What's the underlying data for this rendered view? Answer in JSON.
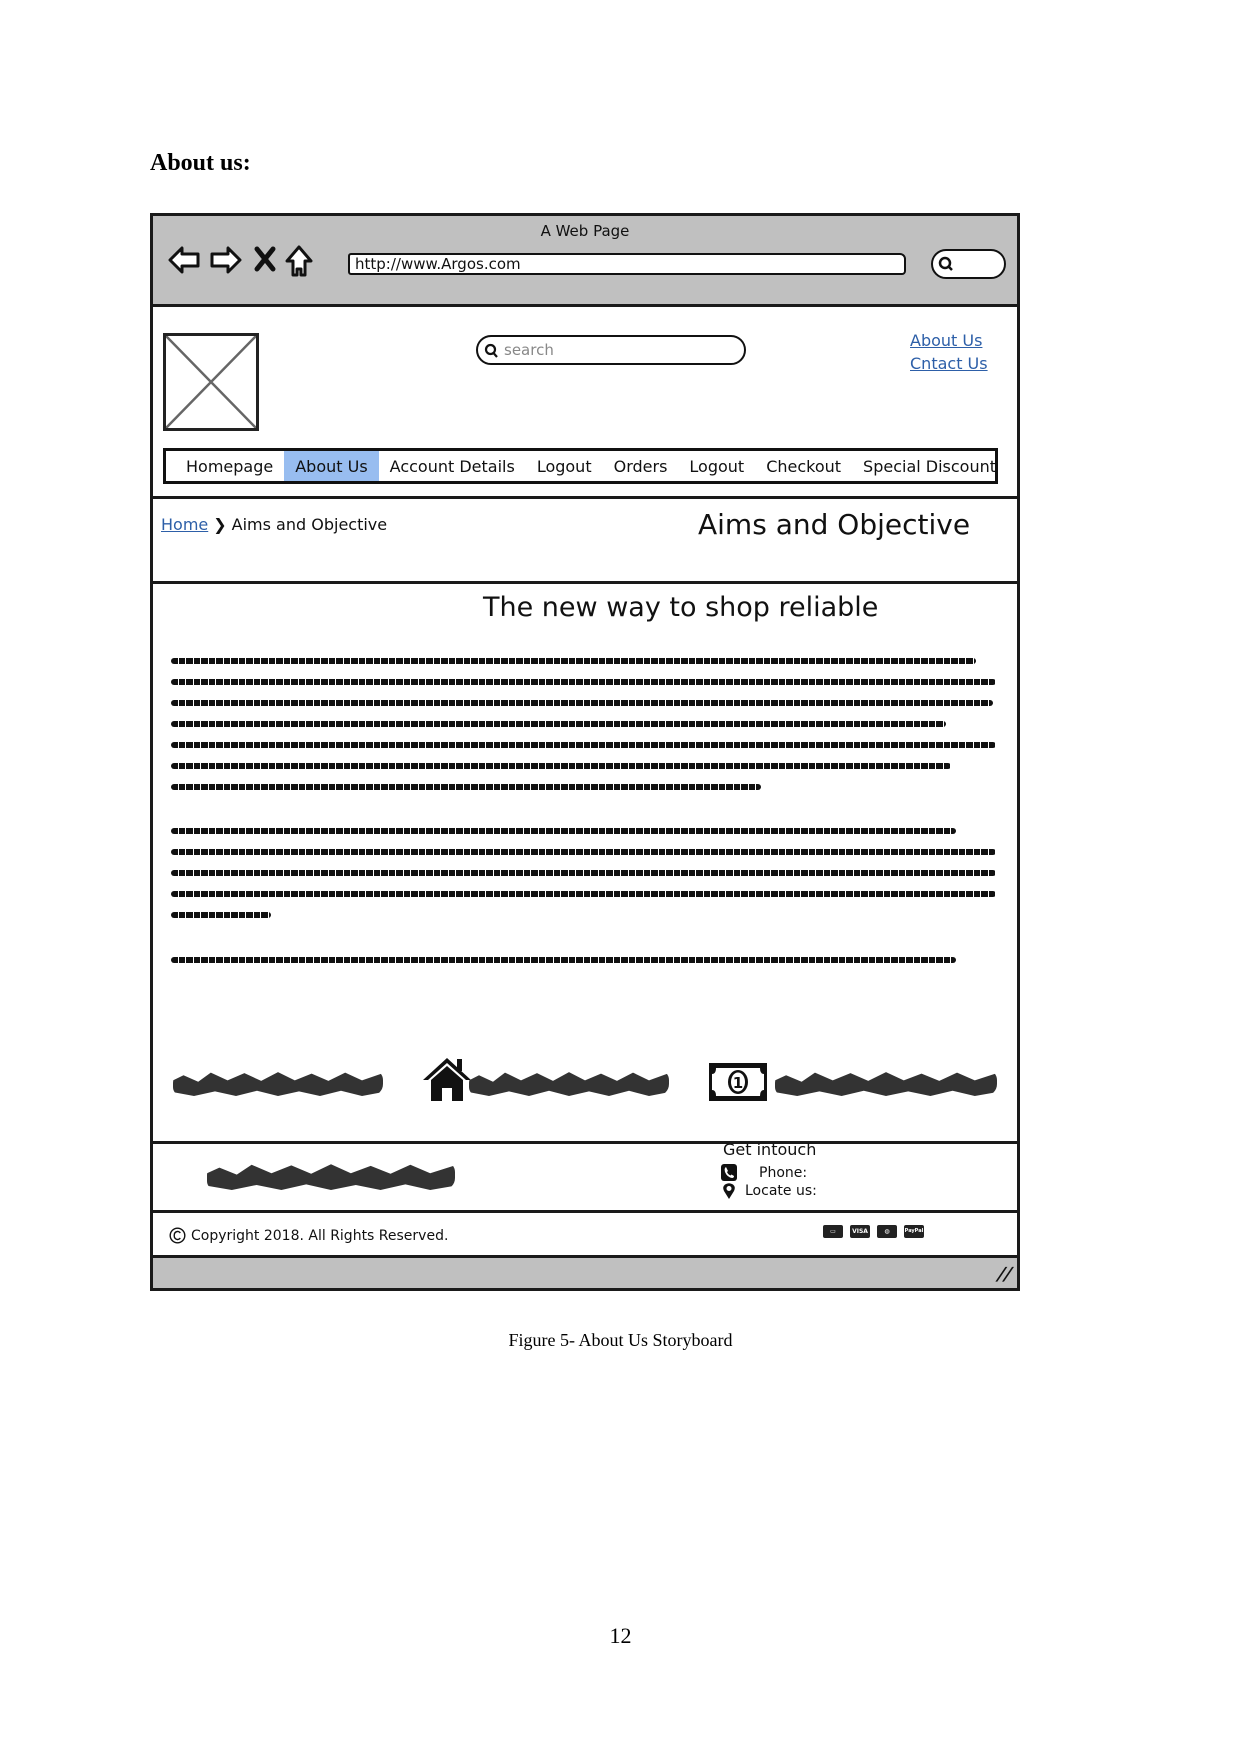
{
  "document": {
    "heading": "About us:",
    "caption": "Figure 5- About Us Storyboard",
    "page_number": "12"
  },
  "mockup": {
    "browser": {
      "window_title": "A Web Page",
      "url": "http://www.Argos.com",
      "toolbar_icons": [
        "back-arrow-icon",
        "forward-arrow-icon",
        "stop-icon",
        "home-icon"
      ],
      "search_icon": "search-icon"
    },
    "header": {
      "logo_placeholder": "image-placeholder",
      "search_placeholder": "search",
      "links": [
        "About Us",
        "Cntact Us"
      ]
    },
    "nav": {
      "items": [
        {
          "label": "Homepage",
          "active": false
        },
        {
          "label": "About Us",
          "active": true
        },
        {
          "label": "Account Details",
          "active": false
        },
        {
          "label": "Logout",
          "active": false
        },
        {
          "label": "Orders",
          "active": false
        },
        {
          "label": "Logout",
          "active": false
        },
        {
          "label": "Checkout",
          "active": false
        },
        {
          "label": "Special Discount",
          "active": false
        }
      ],
      "active_color": "#98bdf0"
    },
    "breadcrumb": {
      "home": "Home",
      "separator": "❯",
      "current": "Aims and Objective"
    },
    "page_heading": "Aims and Objective",
    "content": {
      "title": "The new way to shop reliable",
      "paragraphs_note": "placeholder scribble text",
      "feature_icons": [
        "house-icon",
        "money-bill-icon"
      ]
    },
    "footer": {
      "title": "Get intouch",
      "phone_label": "Phone:",
      "locate_label": "Locate us:",
      "copyright": "Copyright 2018. All Rights Reserved.",
      "payment_icons": [
        "card-icon",
        "VISA",
        "mastercard-icon",
        "PayPal"
      ]
    },
    "link_color": "#2d5fa8",
    "chrome_color": "#c0c0c0"
  }
}
